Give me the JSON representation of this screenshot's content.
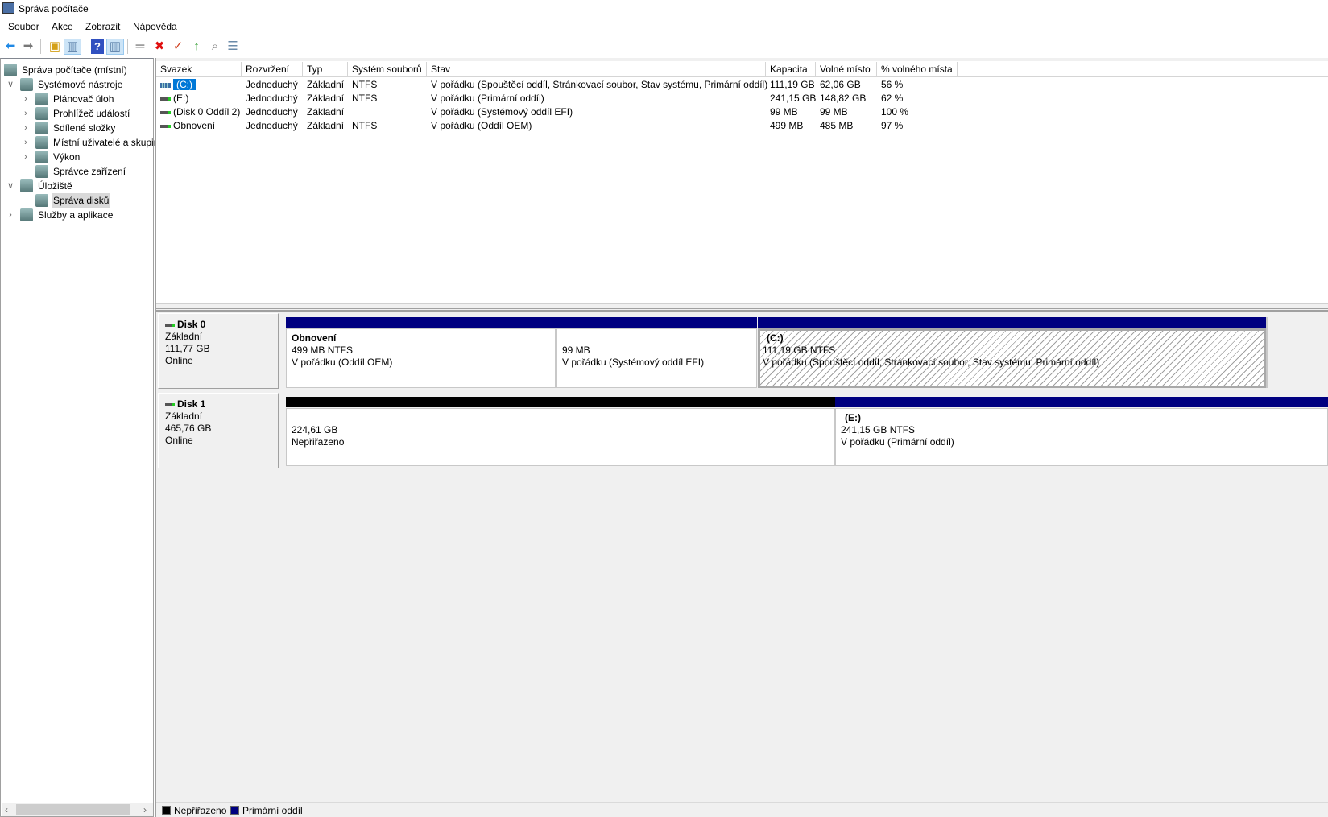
{
  "window": {
    "title": "Správa počítače"
  },
  "menu": [
    "Soubor",
    "Akce",
    "Zobrazit",
    "Nápověda"
  ],
  "toolbar": [
    "back-icon",
    "forward-icon",
    "up-folder-icon",
    "show-hide-console-tree-icon",
    "help-icon",
    "show-hide-action-pane-icon",
    "connect-icon",
    "delete-icon",
    "properties-icon",
    "import-icon",
    "search-icon",
    "list-icon"
  ],
  "tree": [
    {
      "label": "Správa počítače (místní)",
      "level": 0,
      "expander": "",
      "icon": "computer-icon"
    },
    {
      "label": "Systémové nástroje",
      "level": 1,
      "expander": "open",
      "icon": "tools-icon"
    },
    {
      "label": "Plánovač úloh",
      "level": 2,
      "expander": "closed",
      "icon": "clock-icon"
    },
    {
      "label": "Prohlížeč událostí",
      "level": 2,
      "expander": "closed",
      "icon": "event-log-icon"
    },
    {
      "label": "Sdílené složky",
      "level": 2,
      "expander": "closed",
      "icon": "shared-folder-icon"
    },
    {
      "label": "Místní uživatelé a skupiny",
      "level": 2,
      "expander": "closed",
      "icon": "users-icon"
    },
    {
      "label": "Výkon",
      "level": 2,
      "expander": "closed",
      "icon": "performance-icon"
    },
    {
      "label": "Správce zařízení",
      "level": 2,
      "expander": "",
      "icon": "device-manager-icon"
    },
    {
      "label": "Úložiště",
      "level": 1,
      "expander": "open",
      "icon": "storage-icon"
    },
    {
      "label": "Správa disků",
      "level": 2,
      "expander": "",
      "icon": "disk-icon",
      "selected": true
    },
    {
      "label": "Služby a aplikace",
      "level": 1,
      "expander": "closed",
      "icon": "services-icon"
    }
  ],
  "table": {
    "columns": [
      "Svazek",
      "Rozvržení",
      "Typ",
      "Systém souborů",
      "Stav",
      "Kapacita",
      "Volné místo",
      "% volného místa"
    ],
    "rows": [
      [
        "(C:)",
        "Jednoduchý",
        "Základní",
        "NTFS",
        "V pořádku (Spouštěcí oddíl, Stránkovací soubor, Stav systému, Primární oddíl)",
        "111,19 GB",
        "62,06 GB",
        "56 %"
      ],
      [
        "(E:)",
        "Jednoduchý",
        "Základní",
        "NTFS",
        "V pořádku (Primární oddíl)",
        "241,15 GB",
        "148,82 GB",
        "62 %"
      ],
      [
        "(Disk 0 Oddíl 2)",
        "Jednoduchý",
        "Základní",
        "",
        "V pořádku (Systémový oddíl EFI)",
        "99 MB",
        "99 MB",
        "100 %"
      ],
      [
        "Obnovení",
        "Jednoduchý",
        "Základní",
        "NTFS",
        "V pořádku (Oddíl OEM)",
        "499 MB",
        "485 MB",
        "97 %"
      ]
    ]
  },
  "disks": [
    {
      "name": "Disk 0",
      "type": "Základní",
      "size": "111,77 GB",
      "status": "Online",
      "partitions": [
        {
          "name": "Obnovení",
          "size": "499 MB NTFS",
          "status": "V pořádku (Oddíl OEM)",
          "kind": "primary"
        },
        {
          "name": "",
          "size": "99 MB",
          "status": "V pořádku (Systémový oddíl EFI)",
          "kind": "primary"
        },
        {
          "name": "(C:)",
          "size": "111,19 GB NTFS",
          "status": "V pořádku (Spouštěcí oddíl, Stránkovací soubor, Stav systému, Primární oddíl)",
          "kind": "primary",
          "selected": true
        }
      ]
    },
    {
      "name": "Disk 1",
      "type": "Základní",
      "size": "465,76 GB",
      "status": "Online",
      "partitions": [
        {
          "name": "",
          "size": "224,61 GB",
          "status": "Nepřiřazeno",
          "kind": "unallocated"
        },
        {
          "name": "(E:)",
          "size": "241,15 GB NTFS",
          "status": "V pořádku (Primární oddíl)",
          "kind": "primary"
        }
      ]
    }
  ],
  "legend": [
    {
      "label": "Nepřiřazeno",
      "color": "#000000"
    },
    {
      "label": "Primární oddíl",
      "color": "#000080"
    }
  ],
  "colors": {
    "primary": "#000080",
    "unallocated": "#000000",
    "selection": "#0078d7"
  }
}
